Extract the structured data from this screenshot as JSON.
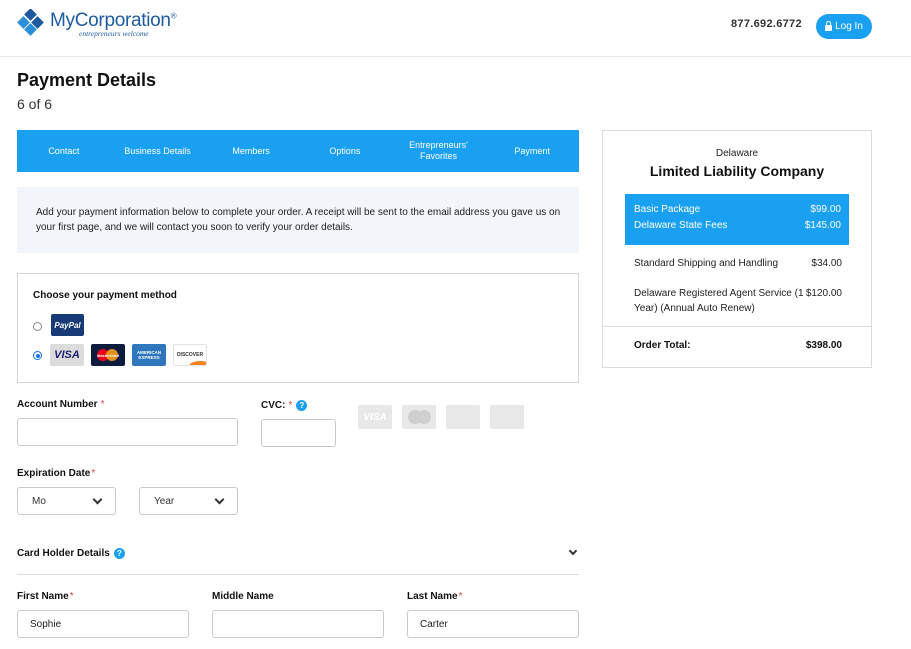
{
  "header": {
    "brand": "MyCorporation",
    "trademark": "®",
    "tagline": "entrepreneurs welcome",
    "phone": "877.692.6772",
    "login_label": "Log In"
  },
  "page": {
    "title": "Payment Details",
    "step": "6 of 6"
  },
  "steps": [
    {
      "label": "Contact"
    },
    {
      "label": "Business Details"
    },
    {
      "label": "Members"
    },
    {
      "label": "Options"
    },
    {
      "label": "Entrepreneurs' Favorites"
    },
    {
      "label": "Payment"
    }
  ],
  "info_text": "Add your payment information below to complete your order. A receipt will be sent to the email address you gave us on your first page, and we will contact you soon to verify your order details.",
  "payment_method": {
    "title": "Choose your payment method",
    "selected": "card",
    "paypal_label": "PayPal",
    "cards": {
      "visa": "VISA",
      "mastercard": "MasterCard",
      "amex": "AMERICAN EXPRESS",
      "discover": "DISCOVER"
    }
  },
  "form": {
    "required_mark": "*",
    "account_number": {
      "label": "Account Number",
      "value": ""
    },
    "cvc": {
      "label": "CVC:",
      "value": "",
      "help": "?"
    },
    "expiration": {
      "label": "Expiration Date",
      "month": "Mo",
      "year": "Year"
    },
    "card_holder": {
      "title": "Card Holder Details",
      "help": "?",
      "first_name": {
        "label": "First Name",
        "value": "Sophie"
      },
      "middle_name": {
        "label": "Middle Name",
        "value": ""
      },
      "last_name": {
        "label": "Last Name",
        "value": "Carter"
      }
    }
  },
  "summary": {
    "state": "Delaware",
    "entity": "Limited Liability Company",
    "highlighted": [
      {
        "label": "Basic Package",
        "amount": "$99.00"
      },
      {
        "label": "Delaware State Fees",
        "amount": "$145.00"
      }
    ],
    "items": [
      {
        "label": "Standard Shipping and Handling",
        "amount": "$34.00"
      },
      {
        "label": "Delaware Registered Agent Service (1 Year) (Annual Auto Renew)",
        "amount": "$120.00"
      }
    ],
    "total_label": "Order Total:",
    "total_amount": "$398.00"
  },
  "colors": {
    "accent": "#1aa0f0",
    "brand": "#1d5a9e",
    "required": "#e0413b"
  }
}
